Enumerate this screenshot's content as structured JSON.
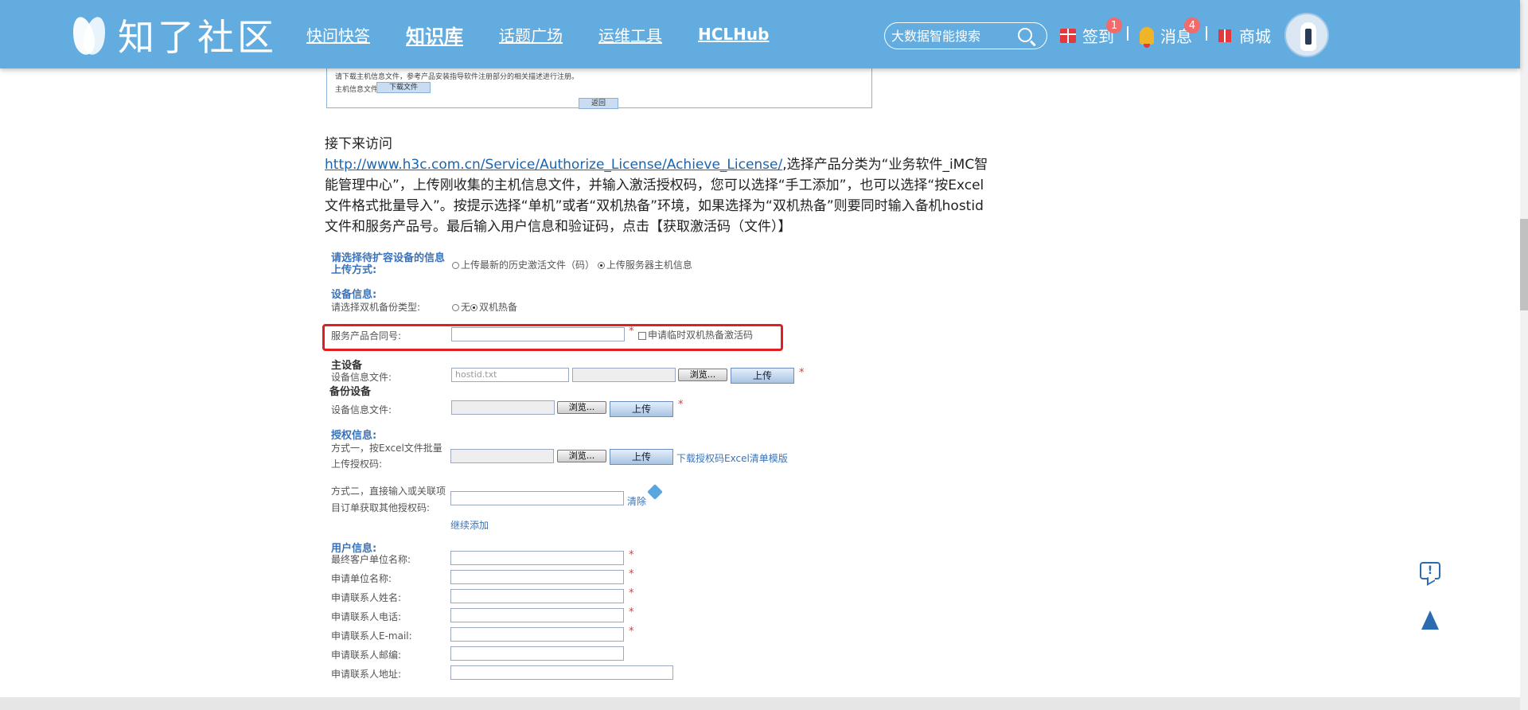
{
  "header": {
    "logo_text": "知了社区",
    "nav": [
      {
        "label": "快问快答"
      },
      {
        "label": "知识库"
      },
      {
        "label": "话题广场"
      },
      {
        "label": "运维工具"
      },
      {
        "label": "HCLHub"
      }
    ],
    "search_placeholder": "大数据智能搜索",
    "signin_label": "签到",
    "signin_badge": "1",
    "messages_label": "消息",
    "messages_badge": "4",
    "shop_label": "商城",
    "colors": {
      "header_bg": "#63ace0",
      "badge": "#f26b6b"
    }
  },
  "top_image": {
    "hint_text": "请下载主机信息文件，参考产品安装指导软件注册部分的相关描述进行注册。",
    "host_info_label": "主机信息文件",
    "download_button": "下载文件",
    "back_button": "返回"
  },
  "article": {
    "intro": "接下来访问",
    "link": "http://www.h3c.com.cn/Service/Authorize_License/Achieve_License/",
    "text": ",选择产品分类为“业务软件_iMC智能管理中心”，上传刚收集的主机信息文件，并输入激活授权码，您可以选择“手工添加”，也可以选择“按Excel文件格式批量导入”。按提示选择“单机”或者“双机热备”环境，如果选择为“双机热备”则要同时输入备机hostid文件和服务产品号。最后输入用户信息和验证码，点击【获取激活码（文件）】"
  },
  "form": {
    "upload_method_label": "请选择待扩容设备的信息上传方式:",
    "upload_opt1": "上传最新的历史激活文件（码）",
    "upload_opt2": "上传服务器主机信息",
    "device_info_section": "设备信息:",
    "backup_type_label": "请选择双机备份类型:",
    "backup_opt_none": "无",
    "backup_opt_hot": "双机热备",
    "service_contract_label": "服务产品合同号:",
    "temp_activation_label": "申请临时双机热备激活码",
    "main_device_section": "主设备",
    "device_file_label": "设备信息文件:",
    "main_file_value": "hostid.txt",
    "browse_label": "浏览...",
    "upload_label": "上传",
    "backup_device_section": "备份设备",
    "license_section": "授权信息:",
    "method1_label_a": "方式一，按Excel文件批量",
    "method1_label_b": "上传授权码:",
    "download_template_link": "下载授权码Excel清单模版",
    "method2_label_a": "方式二，直接输入或关联项",
    "method2_label_b": "目订单获取其他授权码:",
    "clear_link": "清除",
    "continue_add_link": "继续添加",
    "user_info_section": "用户信息:",
    "user_fields": [
      {
        "label": "最终客户单位名称:",
        "required": true
      },
      {
        "label": "申请单位名称:",
        "required": true
      },
      {
        "label": "申请联系人姓名:",
        "required": true
      },
      {
        "label": "申请联系人电话:",
        "required": true
      },
      {
        "label": "申请联系人E-mail:",
        "required": true
      },
      {
        "label": "申请联系人邮编:",
        "required": false
      },
      {
        "label": "申请联系人地址:",
        "required": false
      }
    ],
    "required_mark": "*"
  },
  "side": {
    "feedback_icon": "feedback-icon",
    "back_to_top_icon": "back-to-top-icon",
    "feedback_glyph": "!"
  }
}
